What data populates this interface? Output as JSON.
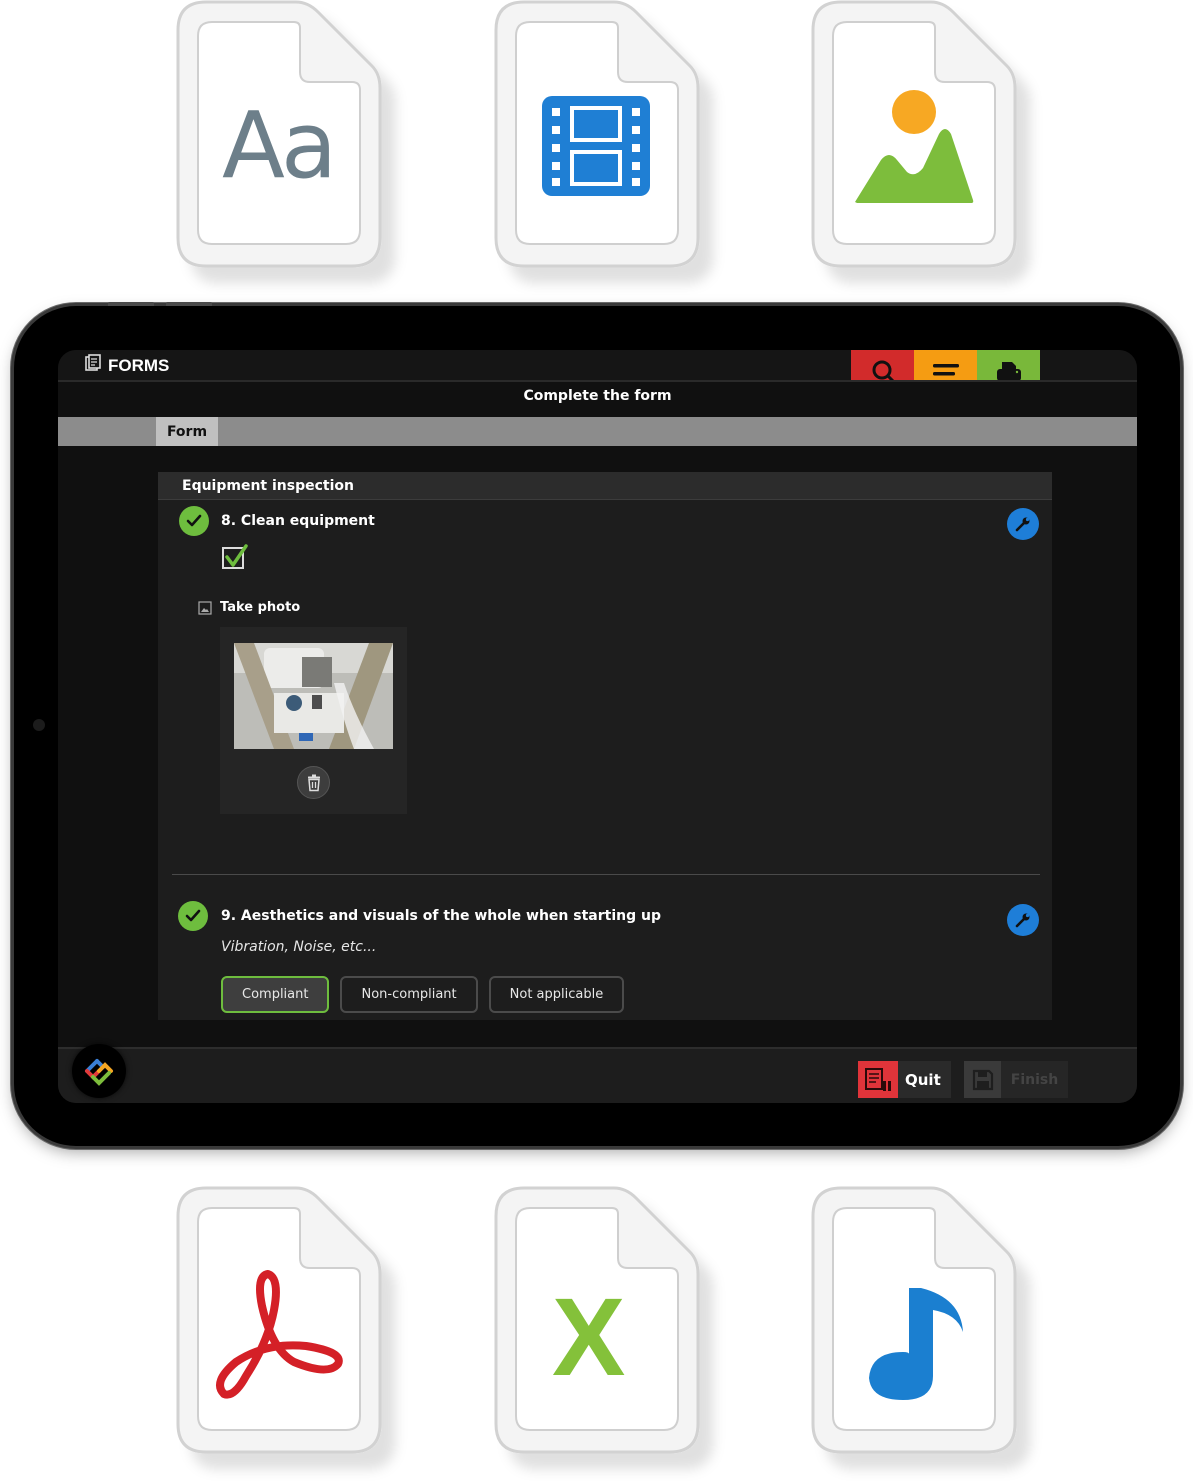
{
  "file_types": [
    {
      "name": "text-document",
      "glyph": "Aa"
    },
    {
      "name": "video-file",
      "glyph": "film"
    },
    {
      "name": "image-file",
      "glyph": "landscape"
    },
    {
      "name": "pdf-file",
      "glyph": "acrobat"
    },
    {
      "name": "excel-file",
      "glyph": "X"
    },
    {
      "name": "audio-file",
      "glyph": "music-note"
    }
  ],
  "app": {
    "title": "FORMS",
    "title_icon": "forms-icon",
    "toolbar": [
      {
        "name": "search",
        "icon": "search-icon",
        "color": "#d22b2b"
      },
      {
        "name": "menu",
        "icon": "menu-icon",
        "color": "#f59c12"
      },
      {
        "name": "print",
        "icon": "print-icon",
        "color": "#79b83a"
      }
    ],
    "subtitle": "Complete the form"
  },
  "tabs": [
    {
      "label": "Form",
      "active": true
    }
  ],
  "form": {
    "section_title": "Equipment inspection",
    "questions": [
      {
        "number_title": "8. Clean equipment",
        "status": "completed",
        "checkbox_checked": true,
        "photo_label": "Take photo",
        "photo_alt": "Industrial equipment photo"
      },
      {
        "number_title": "9. Aesthetics and visuals of the whole when starting up",
        "status": "completed",
        "subtitle": "Vibration, Noise, etc...",
        "options": [
          {
            "label": "Compliant",
            "selected": true
          },
          {
            "label": "Non-compliant",
            "selected": false
          },
          {
            "label": "Not applicable",
            "selected": false
          }
        ]
      }
    ]
  },
  "footer": {
    "quit_label": "Quit",
    "finish_label": "Finish",
    "finish_enabled": false
  },
  "colors": {
    "accent_green": "#6ebd3e",
    "accent_blue": "#1e7ed8",
    "quit_red": "#e0343a"
  }
}
